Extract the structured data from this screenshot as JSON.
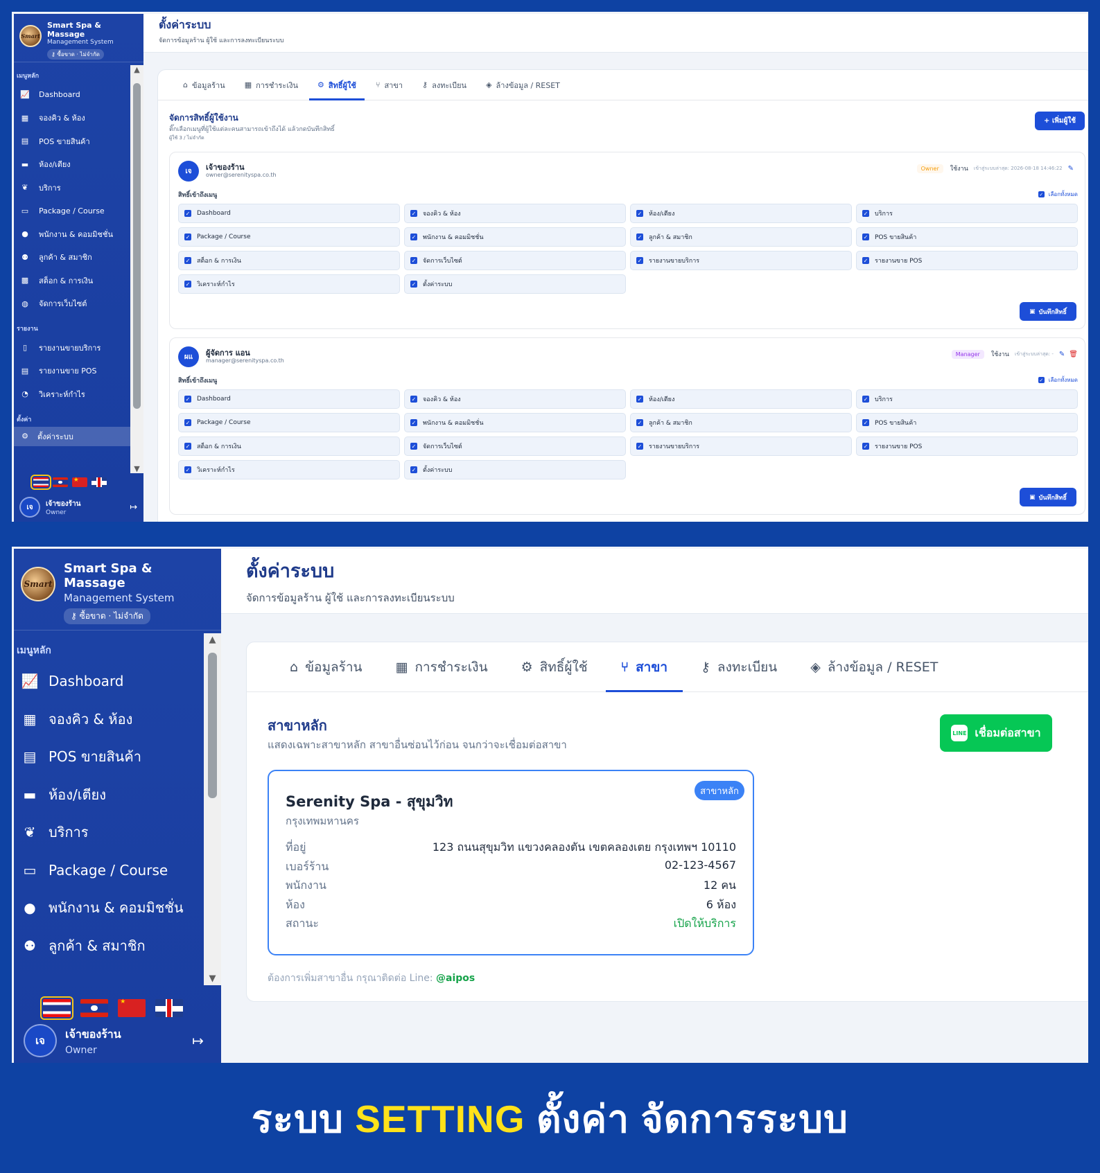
{
  "app": {
    "name": "Smart Spa & Massage",
    "subtitle": "Management System",
    "license": "ซื้อขาด · ไม่จำกัด",
    "logo_text": "Smart"
  },
  "menu": {
    "main_section": "เมนูหลัก",
    "main": [
      {
        "label": "Dashboard",
        "icon": "chart-line-icon"
      },
      {
        "label": "จองคิว & ห้อง",
        "icon": "calendar-check-icon"
      },
      {
        "label": "POS ขายสินค้า",
        "icon": "cash-register-icon"
      },
      {
        "label": "ห้อง/เตียง",
        "icon": "bed-icon"
      },
      {
        "label": "บริการ",
        "icon": "spa-icon"
      },
      {
        "label": "Package / Course",
        "icon": "ticket-icon"
      },
      {
        "label": "พนักงาน & คอมมิชชั่น",
        "icon": "user-tie-icon"
      },
      {
        "label": "ลูกค้า & สมาชิก",
        "icon": "users-icon"
      },
      {
        "label": "สต็อก & การเงิน",
        "icon": "boxes-icon"
      },
      {
        "label": "จัดการเว็บไซต์",
        "icon": "globe-icon"
      }
    ],
    "report_section": "รายงาน",
    "reports": [
      {
        "label": "รายงานขายบริการ",
        "icon": "file-icon"
      },
      {
        "label": "รายงานขาย POS",
        "icon": "receipt-icon"
      },
      {
        "label": "วิเคราะห์กำไร",
        "icon": "chart-pie-icon"
      }
    ],
    "settings_section": "ตั้งค่า",
    "settings_item": "ตั้งค่าระบบ"
  },
  "user": {
    "initials": "เจ",
    "name": "เจ้าของร้าน",
    "role": "Owner"
  },
  "header": {
    "title": "ตั้งค่าระบบ",
    "subtitle": "จัดการข้อมูลร้าน ผู้ใช้ และการลงทะเบียนระบบ"
  },
  "tabs": [
    {
      "label": "ข้อมูลร้าน",
      "icon": "store-icon"
    },
    {
      "label": "การชำระเงิน",
      "icon": "qrcode-icon"
    },
    {
      "label": "สิทธิ์ผู้ใช้",
      "icon": "user-gear-icon"
    },
    {
      "label": "สาขา",
      "icon": "code-branch-icon"
    },
    {
      "label": "ลงทะเบียน",
      "icon": "key-icon"
    },
    {
      "label": "ล้างข้อมูล / RESET",
      "icon": "eraser-icon"
    }
  ],
  "permissions_page": {
    "title": "จัดการสิทธิ์ผู้ใช้งาน",
    "desc": "ติ๊กเลือกเมนูที่ผู้ใช้แต่ละคนสามารถเข้าถึงได้ แล้วกดบันทึกสิทธิ์",
    "count": "ผู้ใช้ 3 / ไม่จำกัด",
    "add_button": "+ เพิ่มผู้ใช้",
    "access_label": "สิทธิ์เข้าถึงเมนู",
    "select_all": "เลือกทั้งหมด",
    "save_button": "บันทึกสิทธิ์",
    "perms": [
      "Dashboard",
      "จองคิว & ห้อง",
      "ห้อง/เตียง",
      "บริการ",
      "Package / Course",
      "พนักงาน & คอมมิชชั่น",
      "ลูกค้า & สมาชิก",
      "POS ขายสินค้า",
      "สต็อก & การเงิน",
      "จัดการเว็บไซต์",
      "รายงานขายบริการ",
      "รายงานขาย POS",
      "วิเคราะห์กำไร",
      "ตั้งค่าระบบ"
    ],
    "users": [
      {
        "initials": "เจ",
        "name": "เจ้าของร้าน",
        "email": "owner@serenityspa.co.th",
        "role": "Owner",
        "status": "ใช้งาน",
        "last_login": "เข้าสู่ระบบล่าสุด: 2026-08-18 14:46:22"
      },
      {
        "initials": "ผแ",
        "name": "ผู้จัดการ แอน",
        "email": "manager@serenityspa.co.th",
        "role": "Manager",
        "status": "ใช้งาน",
        "last_login": "เข้าสู่ระบบล่าสุด: -"
      }
    ]
  },
  "branch_page": {
    "title": "สาขาหลัก",
    "desc": "แสดงเฉพาะสาขาหลัก สาขาอื่นซ่อนไว้ก่อน จนกว่าจะเชื่อมต่อสาขา",
    "connect_button": "เชื่อมต่อสาขา",
    "branch": {
      "name": "Serenity Spa - สุขุมวิท",
      "city": "กรุงเทพมหานคร",
      "badge": "สาขาหลัก",
      "rows": [
        {
          "label": "ที่อยู่",
          "value": "123 ถนนสุขุมวิท แขวงคลองตัน เขตคลองเตย กรุงเทพฯ 10110"
        },
        {
          "label": "เบอร์ร้าน",
          "value": "02-123-4567"
        },
        {
          "label": "พนักงาน",
          "value": "12 คน"
        },
        {
          "label": "ห้อง",
          "value": "6 ห้อง"
        },
        {
          "label": "สถานะ",
          "value": "เปิดให้บริการ"
        }
      ]
    },
    "footer_text": "ต้องการเพิ่มสาขาอื่น กรุณาติดต่อ Line:",
    "footer_line": "@aipos"
  },
  "caption": {
    "part1": "ระบบ",
    "highlight": "SETTING",
    "part2": "ตั้งค่า จัดการระบบ"
  },
  "colors": {
    "accent": "#1d4ed8",
    "sidebar": "#1d43a6",
    "line_green": "#06c755",
    "background": "#0e42a3"
  }
}
